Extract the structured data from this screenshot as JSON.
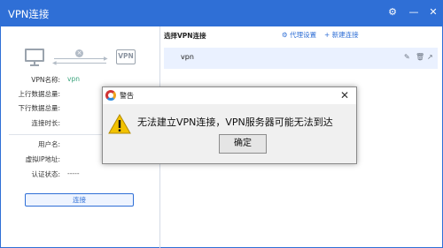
{
  "window": {
    "title": "VPN连接"
  },
  "diagram": {
    "server_label": "VPN"
  },
  "info": {
    "vpn_name_label": "VPN名称:",
    "vpn_name_value": "vpn",
    "upload_label": "上行数据总量:",
    "download_label": "下行数据总量:",
    "duration_label": "连接时长:",
    "username_label": "用户名:",
    "virtual_ip_label": "虚拟IP地址:",
    "auth_status_label": "认证状态:",
    "auth_status_value": "-----"
  },
  "connect_button": "连接",
  "right_panel": {
    "header": "选择VPN连接",
    "proxy_settings": "代理设置",
    "new_connection": "新建连接",
    "connections": [
      {
        "name": "vpn"
      }
    ]
  },
  "dialog": {
    "title": "警告",
    "message": "无法建立VPN连接，VPN服务器可能无法到达",
    "ok_button": "确定"
  },
  "colors": {
    "accent": "#2f6fd6",
    "status_green": "#3aa37c",
    "warning_yellow": "#f2c200"
  }
}
